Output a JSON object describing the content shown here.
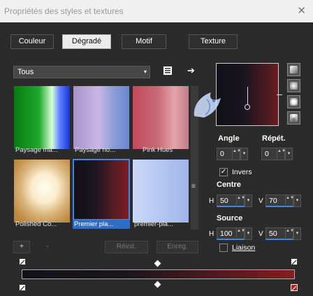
{
  "window": {
    "title": "Propriétés des styles et textures",
    "close_glyph": "✕"
  },
  "tabs": [
    {
      "label": "Couleur"
    },
    {
      "label": "Dégradé"
    },
    {
      "label": "Motif"
    },
    {
      "label": "Texture"
    }
  ],
  "category": {
    "value": "Tous",
    "arrow": "▾"
  },
  "icons": {
    "arrow_right": "➔"
  },
  "gallery": [
    {
      "label": "Paysage ma..."
    },
    {
      "label": "Paysage no..."
    },
    {
      "label": "Pink Hues"
    },
    {
      "label": "Polished Co..."
    },
    {
      "label": "Premier pla..."
    },
    {
      "label": "premier-pla..."
    }
  ],
  "scrollbar": {
    "grip": "≡"
  },
  "angle": {
    "label": "Angle",
    "value": "0"
  },
  "repeat": {
    "label": "Répét.",
    "value": "0"
  },
  "invert": {
    "label": "Invers",
    "checked": true,
    "check_glyph": "✓"
  },
  "centre": {
    "label": "Centre",
    "h_label": "H",
    "h": "50",
    "v_label": "V",
    "v": "70"
  },
  "source": {
    "label": "Source",
    "h_label": "H",
    "h": "100",
    "v_label": "V",
    "v": "50"
  },
  "link": {
    "label": "Liaison",
    "checked": false
  },
  "bottom_buttons": {
    "add": "+",
    "remove": "-",
    "reset": "Réinit.",
    "save": "Enreg."
  },
  "gradient": {
    "start_color": "#111118",
    "end_color": "#8a1c1f"
  },
  "spinner": {
    "glyph": "▲▼"
  },
  "dropdown_glyph": "▾"
}
